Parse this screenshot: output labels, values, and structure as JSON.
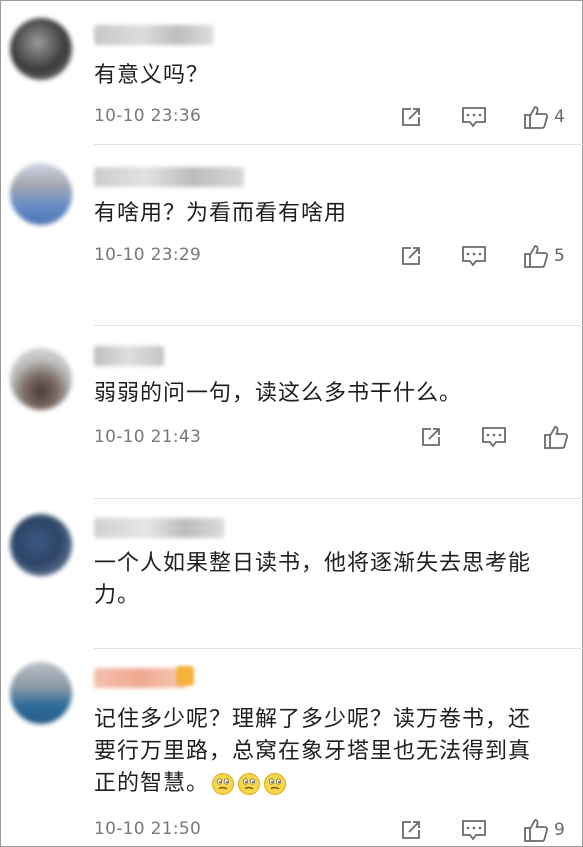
{
  "comments": [
    {
      "text": "有意义吗？",
      "time": "10-10 23:36",
      "likes": "4"
    },
    {
      "text": "有啥用？为看而看有啥用",
      "time": "10-10 23:29",
      "likes": "5"
    },
    {
      "text": "弱弱的问一句，读这么多书干什么。",
      "time": "10-10 21:43",
      "likes": ""
    },
    {
      "text_line1": "一个人如果整日读书，他将逐渐失去思考能",
      "text_line2": "力。"
    },
    {
      "text_line1": "记住多少呢？理解了多少呢？读万卷书，还",
      "text_line2": "要行万里路，总窝在象牙塔里也无法得到真",
      "text_line3": "正的智慧。",
      "emojis": [
        "confused-face-emoji",
        "confused-face-emoji",
        "confused-face-emoji"
      ],
      "time": "10-10 21:50",
      "likes": "9"
    }
  ],
  "icons": {
    "share": "share-icon",
    "reply": "reply-icon",
    "like": "thumbs-up-icon"
  },
  "colors": {
    "icon": "#6a6a6a",
    "time": "#777777",
    "text": "#1f1f1f",
    "separator": "#e3e3e3"
  }
}
